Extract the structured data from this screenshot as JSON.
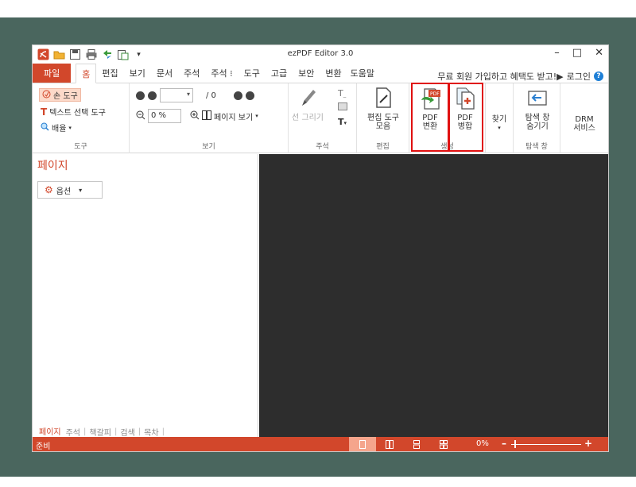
{
  "window": {
    "title": "ezPDF Editor 3.0",
    "quick_access": [
      "app-logo-icon",
      "open-folder-icon",
      "save-icon",
      "print-icon",
      "sync-icon",
      "paste-icon",
      "dropdown-arrow-icon"
    ],
    "controls": {
      "minimize": "–",
      "maximize": "□",
      "close": "✕"
    }
  },
  "tabs": {
    "file": "파일",
    "items": [
      "홈",
      "편집",
      "보기",
      "문서",
      "주석",
      "주석 ⁝",
      "도구",
      "고급",
      "보안",
      "변환",
      "도움말"
    ],
    "active": "홈",
    "promo": "무료 회원 가입하고 혜택도 받고!▶",
    "login": "로그인"
  },
  "ribbon": {
    "tools": {
      "label": "도구",
      "hand": "손 도구",
      "text_select": "텍스트 선택 도구",
      "zoom": "배율"
    },
    "view": {
      "label": "보기",
      "page_total": "/ 0",
      "zoom_value": "0 %",
      "page_view": "페이지 보기"
    },
    "annot": {
      "label": "주석",
      "draw_line": "선 그리기"
    },
    "edit": {
      "label": "편집",
      "edit_tools_1": "편집 도구",
      "edit_tools_2": "모음"
    },
    "create": {
      "label": "생성",
      "convert_1": "PDF",
      "convert_2": "변환",
      "merge_1": "PDF",
      "merge_2": "병합"
    },
    "find": {
      "label": "찾기"
    },
    "nav": {
      "label": "탐색 창",
      "hide_1": "탐색 창",
      "hide_2": "숨기기"
    },
    "drm": {
      "label_1": "DRM",
      "label_2": "서비스"
    }
  },
  "left_panel": {
    "title": "페이지",
    "options": "옵션",
    "tabs": [
      "페이지",
      "주석",
      "책갈피",
      "검색",
      "목차"
    ],
    "active_tab": "페이지"
  },
  "status": {
    "text": "준비",
    "zoom": "0%",
    "minus": "–",
    "plus": "+"
  },
  "colors": {
    "accent": "#d2472b",
    "desktop": "#4a665e",
    "viewer": "#2d2d2d",
    "highlight": "#e01010"
  }
}
